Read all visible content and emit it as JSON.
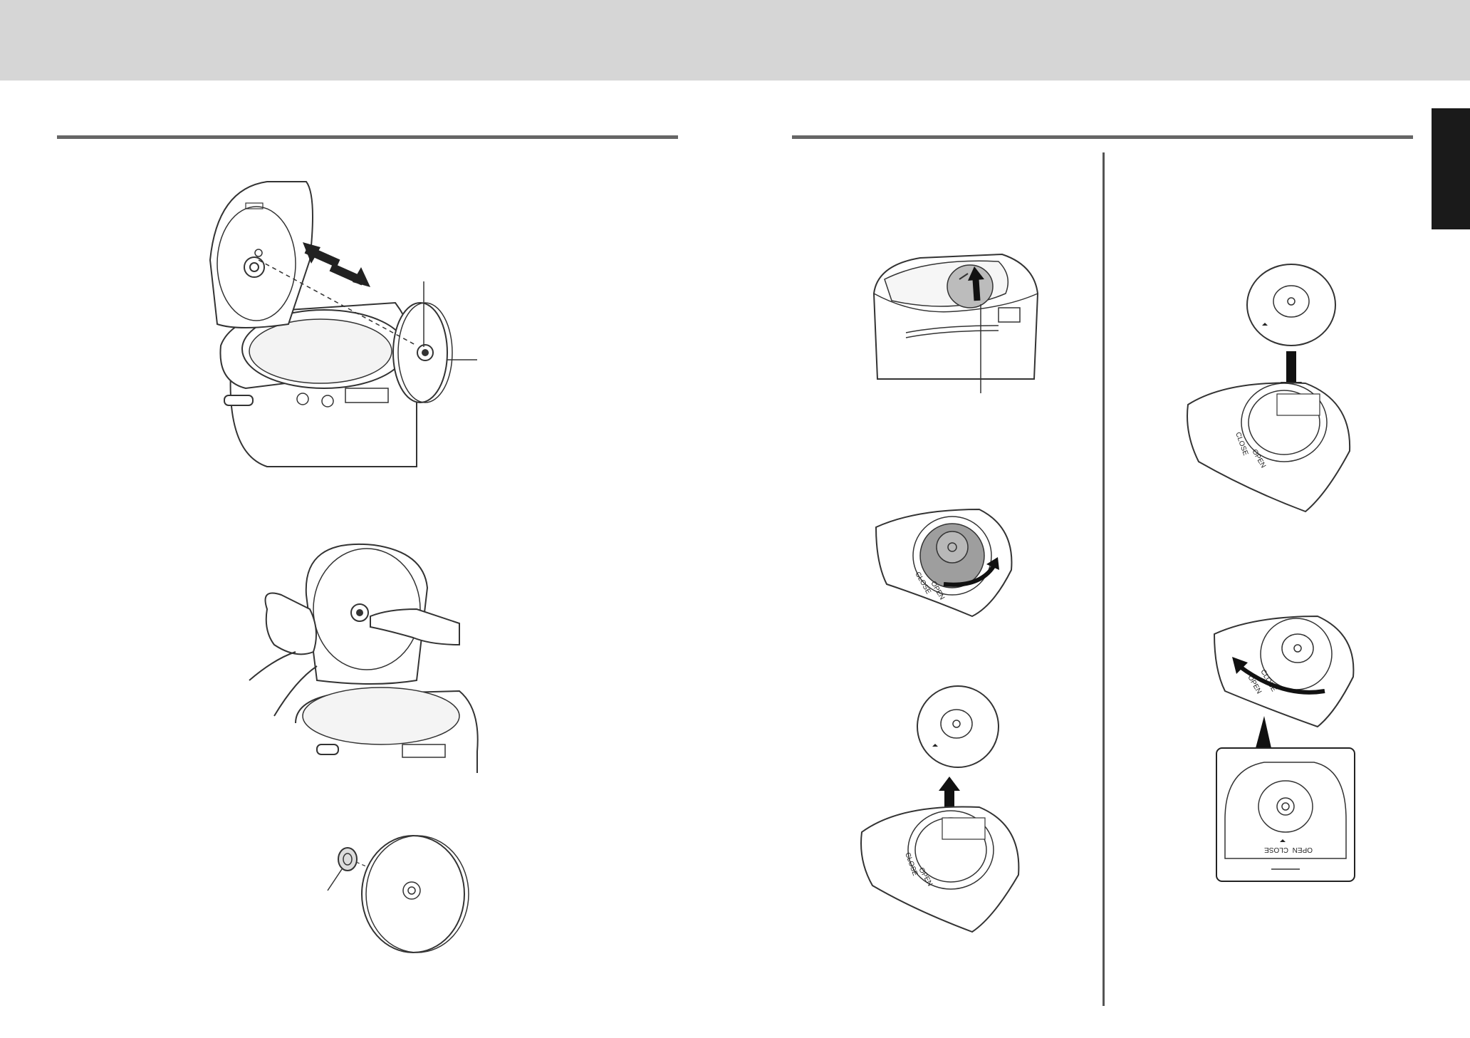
{
  "header": {
    "band_color": "#d6d6d6"
  },
  "side_tab": {
    "color": "#1a1a1a"
  },
  "dial_labels": {
    "close": "CLOSE",
    "open": "OPEN"
  }
}
